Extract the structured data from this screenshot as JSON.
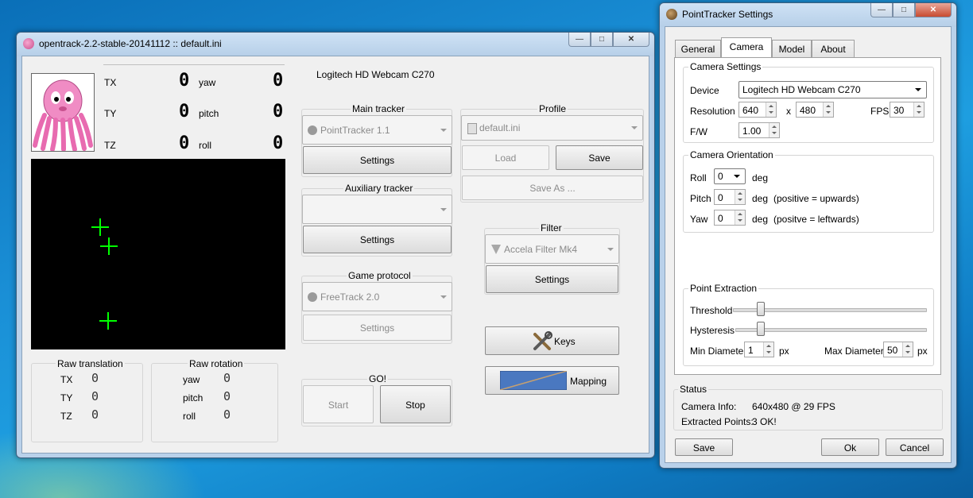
{
  "main_window": {
    "title": "opentrack-2.2-stable-20141112 :: default.ini",
    "caption_buttons": {
      "minimize": "—",
      "maximize": "□",
      "close": "✕"
    },
    "pose": [
      {
        "label": "TX",
        "value": "0"
      },
      {
        "label": "TY",
        "value": "0"
      },
      {
        "label": "TZ",
        "value": "0"
      }
    ],
    "pose_rot": [
      {
        "label": "yaw",
        "value": "0"
      },
      {
        "label": "pitch",
        "value": "0"
      },
      {
        "label": "roll",
        "value": "0"
      }
    ],
    "camera_name": "Logitech HD Webcam C270",
    "main_tracker": {
      "title": "Main tracker",
      "value": "PointTracker 1.1",
      "settings": "Settings"
    },
    "aux_tracker": {
      "title": "Auxiliary tracker",
      "value": "",
      "settings": "Settings"
    },
    "game_protocol": {
      "title": "Game protocol",
      "value": "FreeTrack 2.0",
      "settings": "Settings"
    },
    "go": {
      "title": "GO!",
      "start": "Start",
      "stop": "Stop"
    },
    "profile": {
      "title": "Profile",
      "value": "default.ini",
      "load": "Load",
      "save": "Save",
      "save_as": "Save As ..."
    },
    "filter": {
      "title": "Filter",
      "value": "Accela Filter Mk4",
      "settings": "Settings"
    },
    "keys": "Keys",
    "mapping": "Mapping",
    "raw_translation": {
      "title": "Raw translation",
      "rows": [
        {
          "label": "TX",
          "value": "0"
        },
        {
          "label": "TY",
          "value": "0"
        },
        {
          "label": "TZ",
          "value": "0"
        }
      ]
    },
    "raw_rotation": {
      "title": "Raw rotation",
      "rows": [
        {
          "label": "yaw",
          "value": "0"
        },
        {
          "label": "pitch",
          "value": "0"
        },
        {
          "label": "roll",
          "value": "0"
        }
      ]
    },
    "tracked_points_color": "#00ff00"
  },
  "settings_window": {
    "title": "PointTracker Settings",
    "tabs": [
      "General",
      "Camera",
      "Model",
      "About"
    ],
    "active_tab": "Camera",
    "camera_settings": {
      "title": "Camera Settings",
      "device_label": "Device",
      "device_value": "Logitech HD Webcam C270",
      "resolution_label": "Resolution",
      "res_w": "640",
      "x_label": "x",
      "res_h": "480",
      "fps_label": "FPS",
      "fps": "30",
      "fw_label": "F/W",
      "fw": "1.00"
    },
    "camera_orientation": {
      "title": "Camera Orientation",
      "roll_label": "Roll",
      "roll": "0",
      "roll_unit": "deg",
      "pitch_label": "Pitch",
      "pitch": "0",
      "pitch_unit": "deg",
      "pitch_note": "(positive = upwards)",
      "yaw_label": "Yaw",
      "yaw": "0",
      "yaw_unit": "deg",
      "yaw_note": "(positve = leftwards)"
    },
    "point_extraction": {
      "title": "Point Extraction",
      "threshold_label": "Threshold",
      "hysteresis_label": "Hysteresis",
      "min_diameter_label": "Min Diameter",
      "min_diameter": "1",
      "min_unit": "px",
      "max_diameter_label": "Max Diameter",
      "max_diameter": "50",
      "max_unit": "px"
    },
    "status": {
      "title": "Status",
      "camera_info_label": "Camera Info:",
      "camera_info": "640x480 @ 29 FPS",
      "extracted_label": "Extracted Points:",
      "extracted": "3 OK!"
    },
    "buttons": {
      "save": "Save",
      "ok": "Ok",
      "cancel": "Cancel"
    }
  }
}
